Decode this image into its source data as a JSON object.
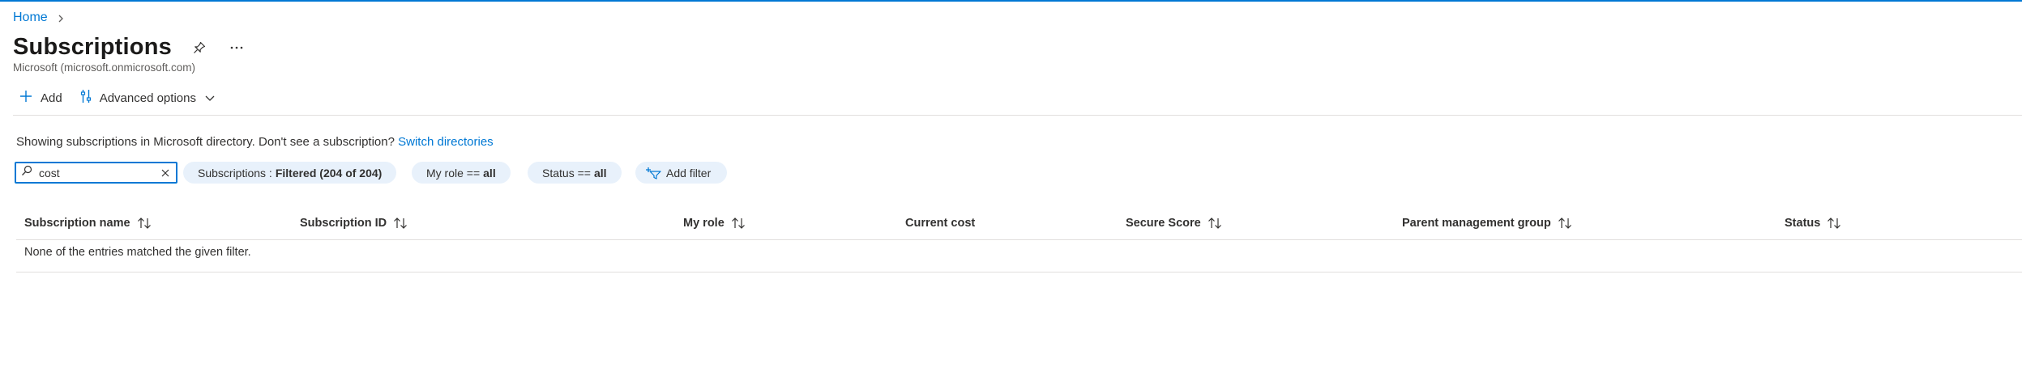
{
  "breadcrumb": {
    "home": "Home"
  },
  "header": {
    "title": "Subscriptions",
    "subtitle": "Microsoft (microsoft.onmicrosoft.com)"
  },
  "toolbar": {
    "add_label": "Add",
    "advanced_label": "Advanced options"
  },
  "info": {
    "text": "Showing subscriptions in Microsoft directory. Don't see a subscription?",
    "link": "Switch directories"
  },
  "search": {
    "value": "cost"
  },
  "filters": {
    "subscriptions_prefix": "Subscriptions :",
    "subscriptions_value": "Filtered (204 of 204)",
    "role_prefix": "My role ==",
    "role_value": "all",
    "status_prefix": "Status ==",
    "status_value": "all",
    "add_filter": "Add filter"
  },
  "table": {
    "columns": [
      "Subscription name",
      "Subscription ID",
      "My role",
      "Current cost",
      "Secure Score",
      "Parent management group",
      "Status"
    ],
    "empty_message": "None of the entries matched the given filter."
  },
  "colors": {
    "accent": "#0078d4",
    "pill_bg": "#e8f1fb",
    "text": "#323130",
    "divider": "#e1dfdd"
  }
}
